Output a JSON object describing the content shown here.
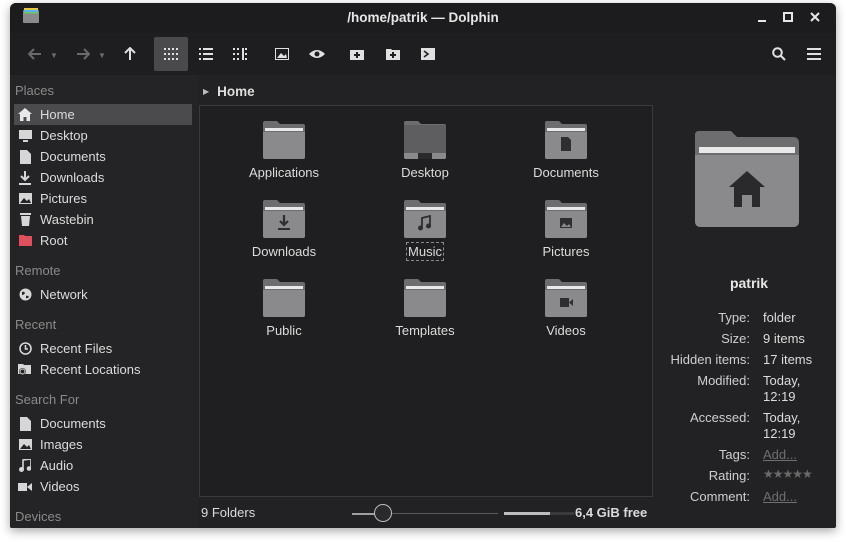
{
  "window": {
    "title": "/home/patrik — Dolphin"
  },
  "toolbar": {
    "buttons": [
      "back-icon",
      "forward-icon",
      "up-icon",
      "icons-view-icon",
      "details-view-icon",
      "compact-view-icon",
      "preview-icon",
      "eye-icon",
      "new-tab-icon",
      "new-folder-icon",
      "terminal-icon",
      "search-icon",
      "menu-icon"
    ]
  },
  "sidebar": {
    "places_title": "Places",
    "places": [
      {
        "label": "Home",
        "icon": "home-icon"
      },
      {
        "label": "Desktop",
        "icon": "desktop-icon"
      },
      {
        "label": "Documents",
        "icon": "document-icon"
      },
      {
        "label": "Downloads",
        "icon": "download-icon"
      },
      {
        "label": "Pictures",
        "icon": "picture-icon"
      },
      {
        "label": "Wastebin",
        "icon": "trash-icon"
      },
      {
        "label": "Root",
        "icon": "root-folder-icon"
      }
    ],
    "remote_title": "Remote",
    "remote": [
      {
        "label": "Network",
        "icon": "network-icon"
      }
    ],
    "recent_title": "Recent",
    "recent": [
      {
        "label": "Recent Files",
        "icon": "clock-icon"
      },
      {
        "label": "Recent Locations",
        "icon": "recent-location-icon"
      }
    ],
    "search_title": "Search For",
    "search": [
      {
        "label": "Documents",
        "icon": "document-icon"
      },
      {
        "label": "Images",
        "icon": "picture-icon"
      },
      {
        "label": "Audio",
        "icon": "music-icon"
      },
      {
        "label": "Videos",
        "icon": "video-icon"
      }
    ],
    "devices_title": "Devices"
  },
  "breadcrumb": {
    "current": "Home"
  },
  "files": [
    {
      "name": "Applications",
      "emblem": "none"
    },
    {
      "name": "Desktop",
      "emblem": "desktop"
    },
    {
      "name": "Documents",
      "emblem": "document"
    },
    {
      "name": "Downloads",
      "emblem": "download"
    },
    {
      "name": "Music",
      "emblem": "music"
    },
    {
      "name": "Pictures",
      "emblem": "picture"
    },
    {
      "name": "Public",
      "emblem": "none"
    },
    {
      "name": "Templates",
      "emblem": "none"
    },
    {
      "name": "Videos",
      "emblem": "video"
    }
  ],
  "status": {
    "count": "9 Folders",
    "free": "6,4 GiB free"
  },
  "info": {
    "name": "patrik",
    "type_label": "Type:",
    "type_value": "folder",
    "size_label": "Size:",
    "size_value": "9 items",
    "hidden_label": "Hidden items:",
    "hidden_value": "17 items",
    "modified_label": "Modified:",
    "modified_value": "Today, 12:19",
    "accessed_label": "Accessed:",
    "accessed_value": "Today, 12:19",
    "tags_label": "Tags:",
    "tags_value": "Add...",
    "rating_label": "Rating:",
    "rating_value": "★★★★★",
    "comment_label": "Comment:",
    "comment_value": "Add..."
  }
}
